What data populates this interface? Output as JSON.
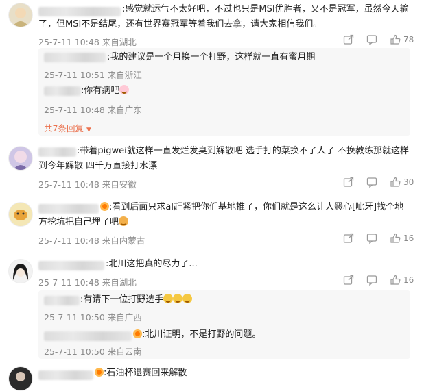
{
  "comments": [
    {
      "text1": ":感觉就运气不太好吧，不过也只是MSI优胜者，又不是冠军，虽然今天输",
      "text2": "了，但MSI不是结尾，还有世界赛冠军等着我们去拿，请大家相信我们。",
      "meta": "25-7-11 10:48 来自湖北",
      "likes": "78",
      "replies": [
        {
          "text": ":我的建议是一个月换一个打野，这样就一直有蜜月期",
          "meta": "25-7-11 10:51 来自浙江"
        },
        {
          "text": ":你有病吧",
          "meta": "25-7-11 10:48 来自广东"
        }
      ],
      "more": "共7条回复"
    },
    {
      "text1": ":带着pigwei就这样一直发烂发臭到解散吧 选手打的菜换不了人了 不换教练那就这样",
      "text2": "到今年解散  四千万直接打水漂",
      "meta": "25-7-11 10:48 来自安徽",
      "likes": "30"
    },
    {
      "text1": ":看到后面只求al赶紧把你们基地推了，你们就是这么让人恶心[呲牙]找个地",
      "text2": "方挖坑把自己埋了吧",
      "meta": "25-7-11 10:48 来自内蒙古",
      "likes": "16"
    },
    {
      "text1": ":北川这把真的尽力了...",
      "meta": "25-7-11 10:48 来自湖北",
      "likes": "16",
      "replies": [
        {
          "text": ":有请下一位打野选手",
          "meta": "25-7-11 10:50 来自广西"
        },
        {
          "text": ":北川证明，不是打野的问题。",
          "meta": "25-7-11 10:50 来自云南"
        }
      ]
    },
    {
      "text1": ":石油杯退赛回来解散"
    }
  ]
}
